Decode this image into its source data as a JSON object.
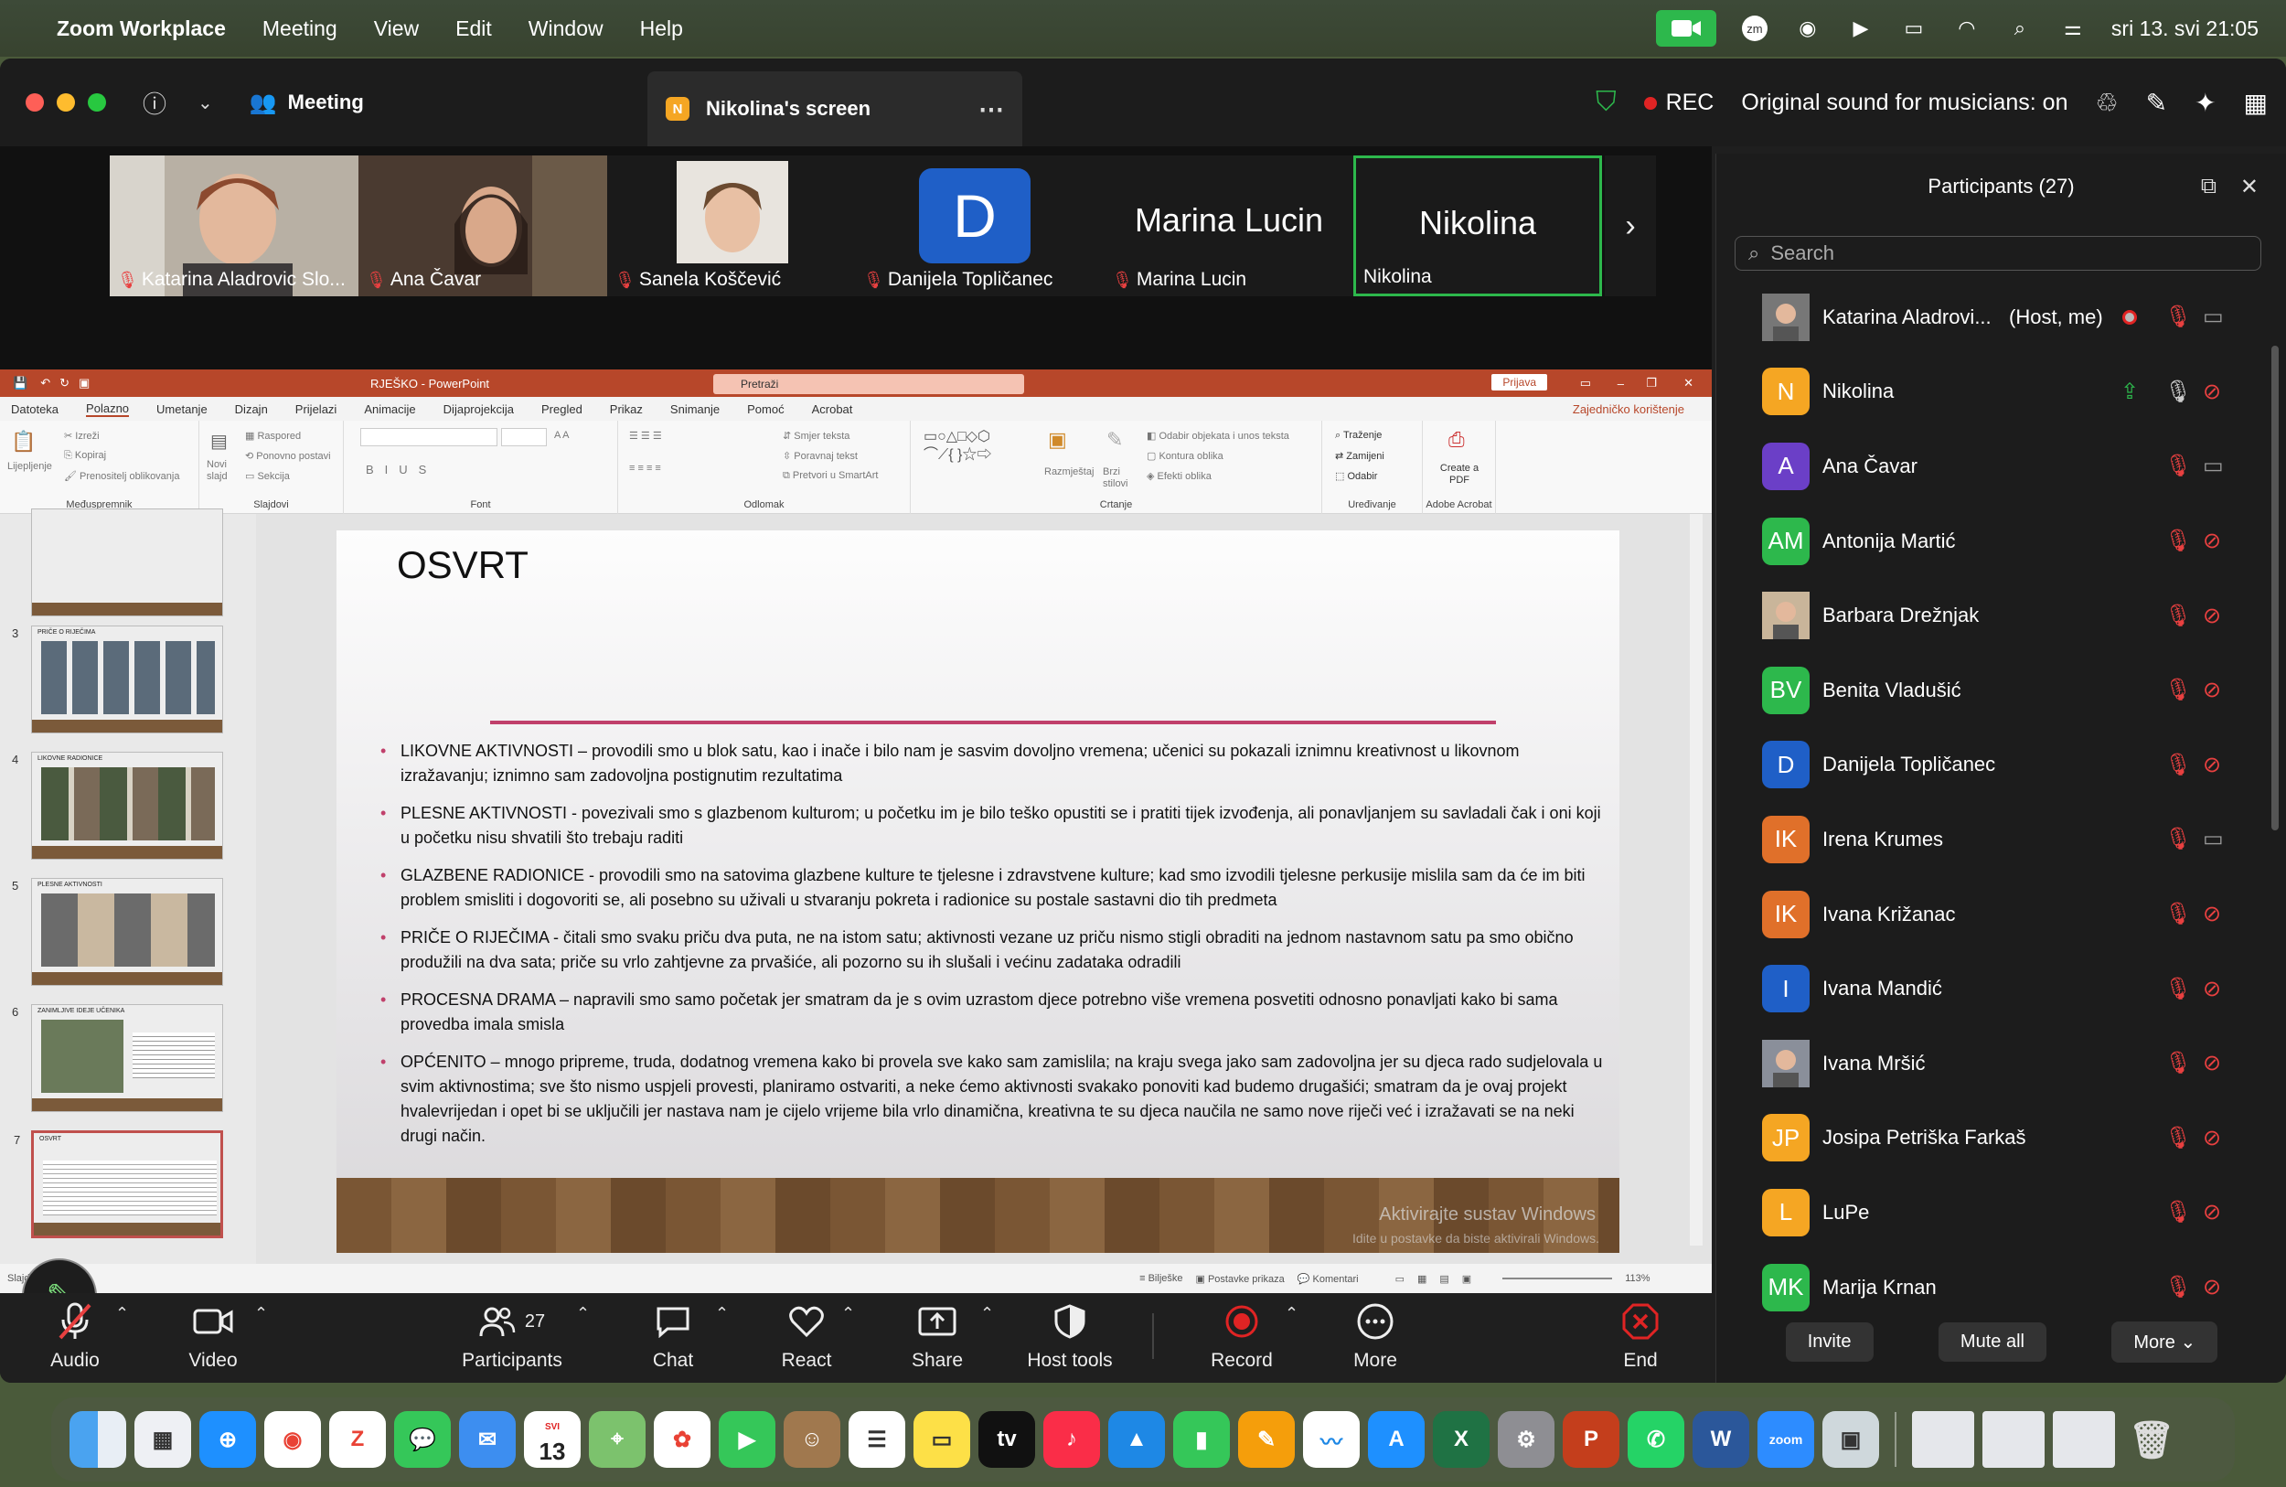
{
  "menubar": {
    "app": "Zoom Workplace",
    "items": [
      "Meeting",
      "View",
      "Edit",
      "Window",
      "Help"
    ],
    "zm_label": "zm",
    "datetime": "sri 13. svi  21:05"
  },
  "titlebar": {
    "meeting_label": "Meeting",
    "tab_badge": "N",
    "tab_label": "Nikolina's screen",
    "rec": "REC",
    "original_sound": "Original sound for musicians: on"
  },
  "videos": [
    {
      "name": "Katarina Aladrovic Slo...",
      "muted": true
    },
    {
      "name": "Ana Čavar",
      "muted": true
    },
    {
      "name": "Sanela Koščević",
      "muted": true
    },
    {
      "name": "Danijela Topličanec",
      "muted": true,
      "avatar": "D"
    },
    {
      "name": "Marina Lucin",
      "muted": true,
      "big": "Marina Lucin"
    },
    {
      "name": "Nikolina",
      "muted": false,
      "big": "Nikolina"
    }
  ],
  "ppt": {
    "title": "RJEŠKO  -  PowerPoint",
    "search": "Pretraži",
    "login": "Prijava",
    "tabs": [
      "Datoteka",
      "Polazno",
      "Umetanje",
      "Dizajn",
      "Prijelazi",
      "Animacije",
      "Dijaprojekcija",
      "Pregled",
      "Prikaz",
      "Snimanje",
      "Pomoć",
      "Acrobat"
    ],
    "share": "Zajedničko korištenje",
    "groups": [
      "Međuspremnik",
      "Slajdovi",
      "Font",
      "Odlomak",
      "Crtanje",
      "Uređivanje",
      "Adobe Acrobat"
    ],
    "ribbon_labels": {
      "cut": "Izreži",
      "copy": "Kopiraj",
      "format": "Prenositelj oblikovanja",
      "paste": "Lijepljenje",
      "new_slide": "Novi slajd",
      "layout": "Raspored",
      "reset": "Ponovno postavi",
      "section": "Sekcija",
      "text_dir": "Smjer teksta",
      "align_text": "Poravnaj tekst",
      "smartart": "Pretvori u SmartArt",
      "arrange": "Razmještaj",
      "quick_styles": "Brzi stilovi",
      "fill": "Odabir objekata i unos teksta",
      "outline": "Kontura oblika",
      "effects": "Efekti oblika",
      "find": "Traženje",
      "replace": "Zamijeni",
      "select": "Odabir",
      "create_pdf": "Create a PDF"
    },
    "thumb_numbers": [
      "3",
      "4",
      "5",
      "6",
      "7"
    ],
    "thumb_titles": [
      "PRIČE O RIJEČIMA",
      "LIKOVNE RADIONICE",
      "PLESNE AKTIVNOSTI",
      "ZANIMLJIVE IDEJE UČENIKA",
      "OSVRT"
    ],
    "slide_title": "OSVRT",
    "bullets": [
      "LIKOVNE AKTIVNOSTI – provodili smo u blok satu, kao i inače i bilo nam je sasvim dovoljno vremena; učenici su pokazali iznimnu kreativnost u likovnom izražavanju; iznimno sam zadovoljna postignutim rezultatima",
      "PLESNE AKTIVNOSTI  - povezivali smo s glazbenom kulturom; u početku im je bilo teško opustiti se i pratiti tijek izvođenja, ali ponavljanjem su savladali čak i oni koji u početku nisu shvatili što trebaju raditi",
      "GLAZBENE RADIONICE - provodili smo na satovima glazbene kulture te tjelesne i zdravstvene kulture; kad smo izvodili tjelesne perkusije mislila sam da će im biti problem smisliti i dogovoriti se, ali posebno su uživali u stvaranju pokreta i radionice su postale sastavni dio tih predmeta",
      "PRIČE O RIJEČIMA  - čitali smo svaku priču dva puta, ne na istom satu; aktivnosti vezane uz priču nismo stigli obraditi na jednom nastavnom satu pa smo obično produžili na dva sata; priče su vrlo zahtjevne za prvašiće, ali pozorno su ih slušali i većinu zadataka odradili",
      "PROCESNA DRAMA – napravili smo samo početak jer smatram da je s ovim uzrastom djece potrebno više vremena posvetiti odnosno ponavljati kako bi sama provedba imala smisla",
      "OPĆENITO – mnogo pripreme, truda, dodatnog vremena kako bi provela sve kako sam zamislila; na kraju svega jako sam zadovoljna jer su djeca rado sudjelovala u svim aktivnostima; sve što nismo uspjeli provesti, planiramo ostvariti, a neke ćemo aktivnosti svakako ponoviti kad budemo drugašići; smatram da je ovaj projekt hvalevrijedan i opet bi se uključili jer nastava nam je cijelo vrijeme bila vrlo dinamična, kreativna te su djeca naučila ne samo nove riječi već i izražavati se na neki drugi način."
    ],
    "watermark": "Aktivirajte sustav Windows",
    "watermark_sub": "Idite u postavke da biste aktivirali Windows.",
    "status_left": "Slajd 7 od 7",
    "status_notes": "Bilješke",
    "status_view": "Postavke prikaza",
    "status_comments": "Komentari",
    "zoom": "113%"
  },
  "toolbar": {
    "audio": "Audio",
    "video": "Video",
    "participants": "Participants",
    "participants_count": "27",
    "chat": "Chat",
    "react": "React",
    "share": "Share",
    "host_tools": "Host tools",
    "record": "Record",
    "more": "More",
    "end": "End"
  },
  "panel": {
    "title": "Participants (27)",
    "search_placeholder": "Search",
    "participants": [
      {
        "name": "Katarina Aladrovi...",
        "tag": "(Host, me)",
        "initials": "",
        "color": "#777777",
        "mic": "muted",
        "cam": "on",
        "photo": true
      },
      {
        "name": "Nikolina",
        "initials": "N",
        "color": "#f5a623",
        "mic": "on",
        "cam": "off",
        "share": true
      },
      {
        "name": "Ana Čavar",
        "initials": "A",
        "color": "#6b3fc7",
        "mic": "muted",
        "cam": "on"
      },
      {
        "name": "Antonija Martić",
        "initials": "AM",
        "color": "#2db84c",
        "mic": "muted",
        "cam": "off"
      },
      {
        "name": "Barbara Drežnjak",
        "initials": "",
        "color": "#c9b59a",
        "mic": "muted",
        "cam": "off",
        "photo": true
      },
      {
        "name": "Benita Vladušić",
        "initials": "BV",
        "color": "#2db84c",
        "mic": "muted",
        "cam": "off"
      },
      {
        "name": "Danijela Topličanec",
        "initials": "D",
        "color": "#1f5fc7",
        "mic": "muted",
        "cam": "off"
      },
      {
        "name": "Irena Krumes",
        "initials": "IK",
        "color": "#e0702a",
        "mic": "muted",
        "cam": "on"
      },
      {
        "name": "Ivana Križanac",
        "initials": "IK",
        "color": "#e0702a",
        "mic": "muted",
        "cam": "off"
      },
      {
        "name": "Ivana Mandić",
        "initials": "I",
        "color": "#1f5fc7",
        "mic": "muted",
        "cam": "off"
      },
      {
        "name": "Ivana Mršić",
        "initials": "",
        "color": "#8a8f9a",
        "mic": "muted",
        "cam": "off",
        "photo": true
      },
      {
        "name": "Josipa Petriška Farkaš",
        "initials": "JP",
        "color": "#f5a623",
        "mic": "muted",
        "cam": "off"
      },
      {
        "name": "LuPe",
        "initials": "L",
        "color": "#f5a623",
        "mic": "muted",
        "cam": "off"
      },
      {
        "name": "Marija Krnan",
        "initials": "MK",
        "color": "#2db84c",
        "mic": "muted",
        "cam": "off"
      }
    ],
    "invite": "Invite",
    "mute_all": "Mute all",
    "more": "More"
  },
  "dock": {
    "calendar_month": "SVI",
    "calendar_day": "13",
    "tv": "tv",
    "zoom": "zoom"
  }
}
